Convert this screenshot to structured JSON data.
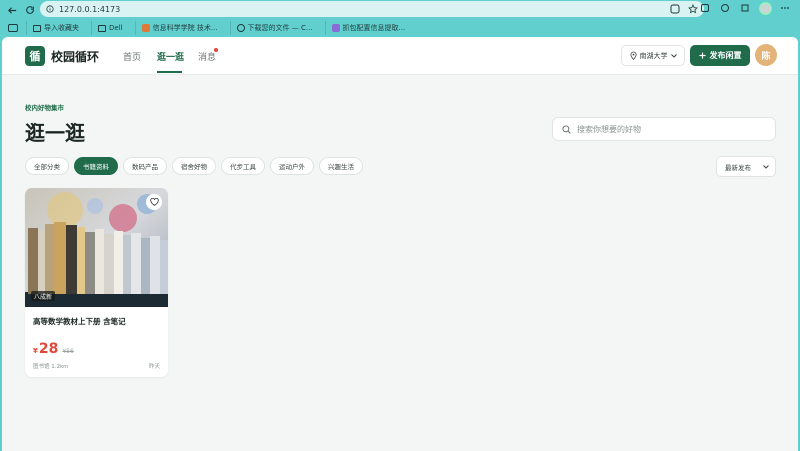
{
  "browser": {
    "url": "127.0.0.1:4173",
    "bookmarks": [
      {
        "label": "导入收藏夹",
        "icon": "folder-icon"
      },
      {
        "label": "Dell",
        "icon": "folder-icon"
      },
      {
        "label": "信息科学学院 技术...",
        "icon": "site-favicon"
      },
      {
        "label": "下载您的文件 — C...",
        "icon": "globe-icon"
      },
      {
        "label": "抓包配置信息提取...",
        "icon": "site-favicon"
      }
    ]
  },
  "header": {
    "logo_glyph": "循",
    "brand": "校园循环",
    "nav": {
      "home": "首页",
      "browse": "逛一逛",
      "messages": "消息"
    },
    "campus": "南湖大学",
    "publish": "发布闲置",
    "avatar": "陈"
  },
  "main": {
    "eyebrow": "校内好物集市",
    "title": "逛一逛",
    "search_placeholder": "搜索你想要的好物",
    "categories": [
      "全部分类",
      "书籍资料",
      "数码产品",
      "宿舍好物",
      "代步工具",
      "运动户外",
      "兴趣生活"
    ],
    "active_category": "书籍资料",
    "sort": "最新发布"
  },
  "listing": {
    "title": "高等数学教材上下册 含笔记",
    "condition": "八成新",
    "currency": "¥",
    "price": "28",
    "original_price": "¥56",
    "location": "图书馆 1.2km",
    "time": "昨天"
  },
  "colors": {
    "accent": "#1f6b4a",
    "price": "#e0483a",
    "badge_dot": "#e0483a",
    "avatar": "#e4b37a"
  }
}
